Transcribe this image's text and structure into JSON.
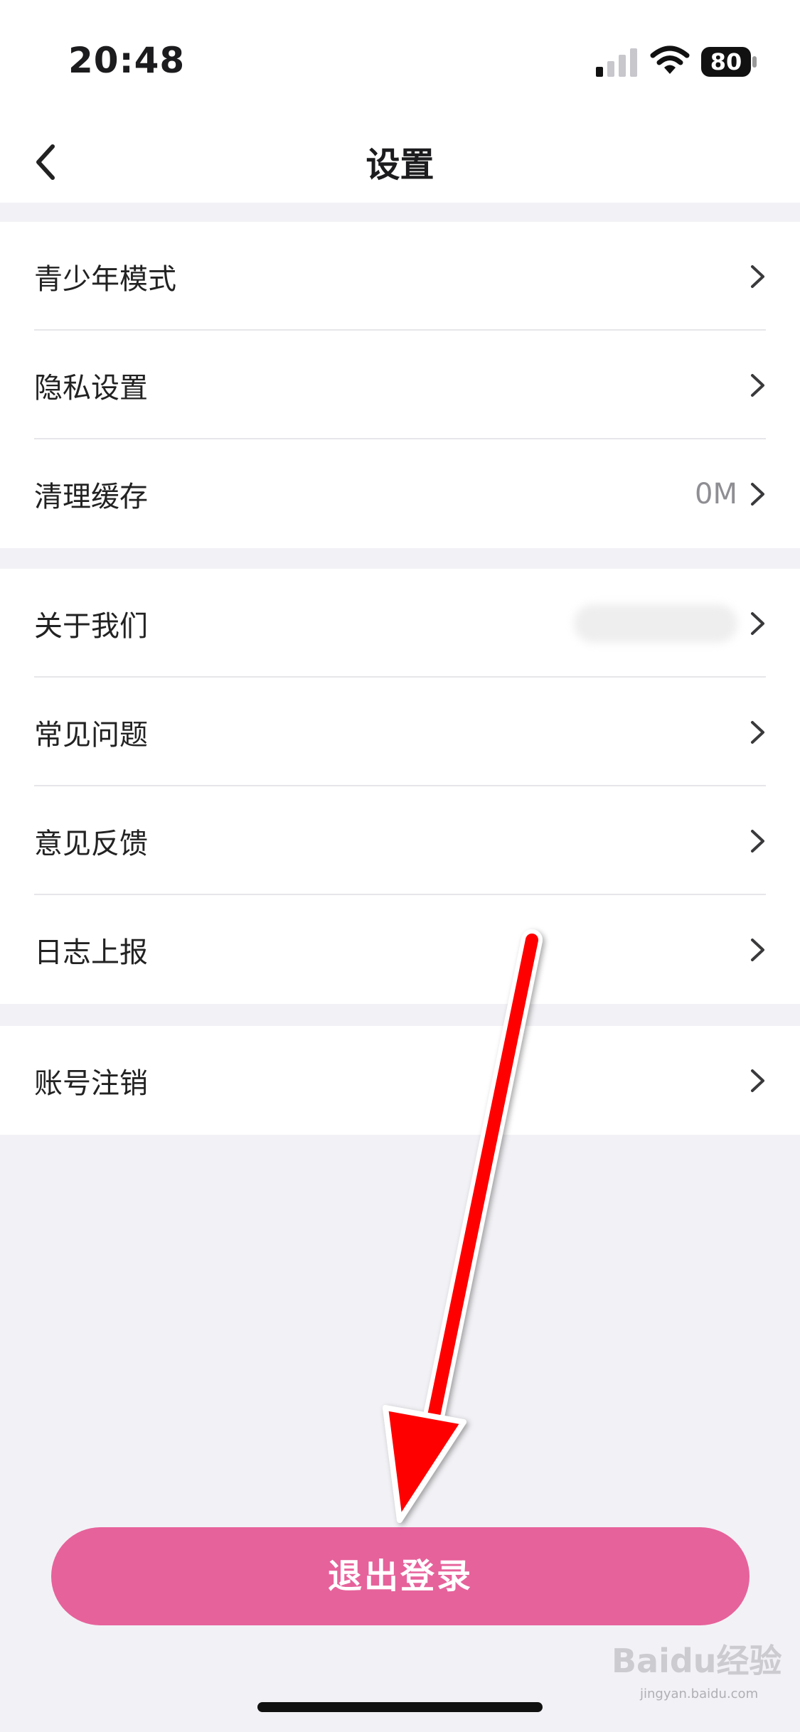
{
  "status_bar": {
    "time": "20:48",
    "battery_level": "80"
  },
  "header": {
    "title": "设置"
  },
  "groups": [
    {
      "items": [
        {
          "label": "青少年模式",
          "value": ""
        },
        {
          "label": "隐私设置",
          "value": ""
        },
        {
          "label": "清理缓存",
          "value": "0M"
        }
      ]
    },
    {
      "items": [
        {
          "label": "关于我们",
          "value": ""
        },
        {
          "label": "常见问题",
          "value": ""
        },
        {
          "label": "意见反馈",
          "value": ""
        },
        {
          "label": "日志上报",
          "value": ""
        }
      ]
    },
    {
      "items": [
        {
          "label": "账号注销",
          "value": ""
        }
      ]
    }
  ],
  "logout_label": "退出登录",
  "watermark": {
    "brand": "Baidu经验",
    "url": "jingyan.baidu.com"
  },
  "colors": {
    "logout_button": "#e6629b",
    "annotation_arrow": "#ff0000",
    "page_background": "#f2f2f6"
  }
}
